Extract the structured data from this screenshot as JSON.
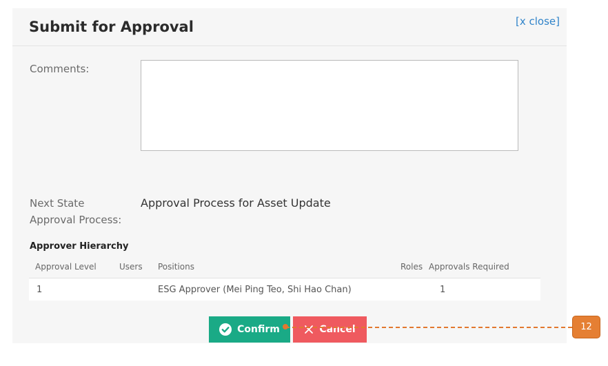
{
  "dialog": {
    "title": "Submit for Approval",
    "close_label": "[x close]",
    "comments_label": "Comments:",
    "comments_value": "",
    "next_state_label_line1": "Next State",
    "next_state_label_line2": "Approval Process:",
    "next_state_value": "Approval Process for Asset Update"
  },
  "hierarchy": {
    "title": "Approver Hierarchy",
    "columns": [
      "Approval Level",
      "Users",
      "Positions",
      "Roles",
      "Approvals Required"
    ],
    "rows": [
      [
        "1",
        "",
        "ESG Approver (Mei Ping Teo, Shi Hao Chan)",
        "",
        "1"
      ]
    ]
  },
  "actions": {
    "confirm_label": "Confirm",
    "cancel_label": "Cancel",
    "confirm_icon": "check-circle-icon",
    "cancel_icon": "x-icon"
  },
  "annotation": {
    "marker_label": "12"
  },
  "colors": {
    "confirm": "#1aaa86",
    "cancel": "#ef5a5f",
    "link": "#2f83c9",
    "annotation": "#e57f33"
  }
}
